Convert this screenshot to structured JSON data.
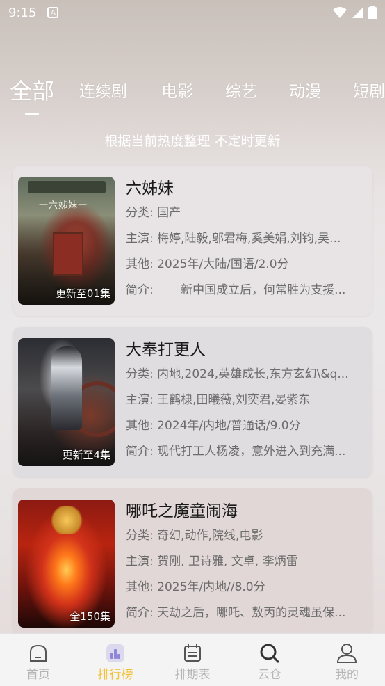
{
  "status_bar": {
    "time": "9:15",
    "notification_glyph": "A"
  },
  "tabs": [
    {
      "label": "全部",
      "active": true
    },
    {
      "label": "连续剧"
    },
    {
      "label": "电影"
    },
    {
      "label": "综艺"
    },
    {
      "label": "动漫"
    },
    {
      "label": "短剧"
    }
  ],
  "subtitle": "根据当前热度整理 不定时更新",
  "items": [
    {
      "title": "六姊妹",
      "poster_title": "一六姊妹一",
      "badge": "更新至01集",
      "category_label": "分类:",
      "category": "国产",
      "cast_label": "主演:",
      "cast": "梅婷,陆毅,邬君梅,奚美娟,刘钧,吴...",
      "other_label": "其他:",
      "other": "2025年/大陆/国语/2.0分",
      "intro_label": "简介:",
      "intro": "　　新中国成立后，何常胜为支援..."
    },
    {
      "title": "大奉打更人",
      "badge": "更新至4集",
      "category_label": "分类:",
      "category": "内地,2024,英雄成长,东方玄幻\\&q...",
      "cast_label": "主演:",
      "cast": "王鹤棣,田曦薇,刘奕君,晏紫东",
      "other_label": "其他:",
      "other": "2024年/内地/普通话/9.0分",
      "intro_label": "简介:",
      "intro": "现代打工人杨凌，意外进入到充满..."
    },
    {
      "title": "哪吒之魔童闹海",
      "badge": "全150集",
      "category_label": "分类:",
      "category": "奇幻,动作,院线,电影",
      "cast_label": "主演:",
      "cast": "贺刚, 卫诗雅, 文卓, 李炳雷",
      "other_label": "其他:",
      "other": "2025年/内地//8.0分",
      "intro_label": "简介:",
      "intro": "天劫之后，哪吒、敖丙的灵魂虽保..."
    }
  ],
  "tabbar": [
    {
      "label": "首页",
      "icon": "home-icon"
    },
    {
      "label": "排行榜",
      "icon": "ranking-icon",
      "active": true
    },
    {
      "label": "排期表",
      "icon": "schedule-icon"
    },
    {
      "label": "云仓",
      "icon": "search-icon"
    },
    {
      "label": "我的",
      "icon": "user-icon"
    }
  ],
  "colors": {
    "accent": "#f2c12e",
    "inactive": "#b5b5b5",
    "text_dark": "#1a1a1a",
    "text_muted": "#6c6c6c"
  }
}
